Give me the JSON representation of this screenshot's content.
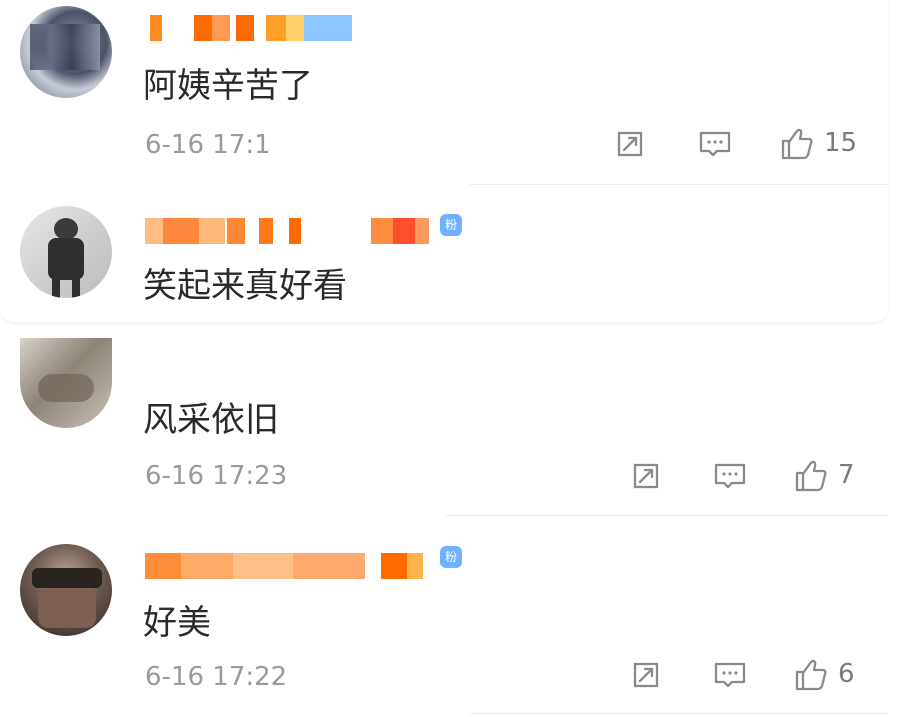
{
  "comments": [
    {
      "text": "阿姨辛苦了",
      "time": "6-16 17:1",
      "likes": "15"
    },
    {
      "text": "笑起来真好看"
    },
    {
      "text": "风采依旧",
      "time": "6-16 17:23",
      "likes": "7"
    },
    {
      "text": "好美",
      "time": "6-16 17:22",
      "likes": "6"
    }
  ],
  "badge": {
    "fan_label": "粉"
  },
  "icons": {
    "share": "share-icon",
    "comment": "comment-icon",
    "like": "thumbs-up-icon"
  },
  "colors": {
    "text": "#2a2a2a",
    "meta": "#9a9a9a",
    "icon": "#8a8a8a",
    "badge": "#6fb0ff",
    "name_orange": "#ff8a1f",
    "name_blue": "#5aa7ff"
  }
}
